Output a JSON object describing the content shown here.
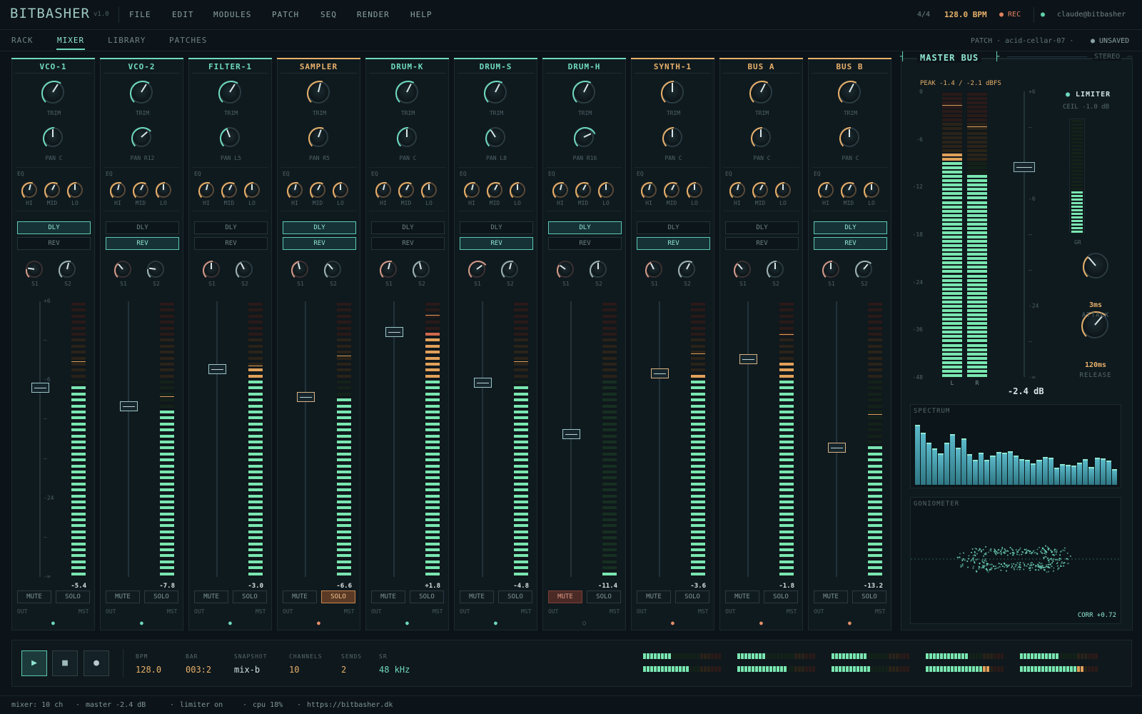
{
  "app": {
    "logo": "BITBASHER",
    "version": "v1.0"
  },
  "menu": [
    "FILE",
    "EDIT",
    "MODULES",
    "PATCH",
    "SEQ",
    "RENDER",
    "HELP"
  ],
  "top": {
    "time_sig": "4/4",
    "bpm": "128.0 BPM",
    "rec": "● REC",
    "user_dot": "●",
    "user": "claude@bitbasher"
  },
  "tabs": [
    "RACK",
    "MIXER",
    "LIBRARY",
    "PATCHES"
  ],
  "active_tab": "MIXER",
  "patch": {
    "label": "PATCH · acid-cellar-07 ·",
    "status": "● UNSAVED"
  },
  "channels": [
    {
      "name": "VCO-1",
      "color": "teal",
      "trim": 0.62,
      "pan_label": "PAN C",
      "pan": 0,
      "dly": true,
      "rev": false,
      "s1": 0.2,
      "s2": 0.55,
      "fader_db": -5.4,
      "meter_db": -5.4,
      "peak_db": -2.0,
      "gain": "-5.4",
      "mute": false,
      "solo": false,
      "route_dot": "teal"
    },
    {
      "name": "VCO-2",
      "color": "teal",
      "trim": 0.62,
      "pan_label": "PAN R12",
      "pan": 0.12,
      "dly": false,
      "rev": true,
      "s1": 0.35,
      "s2": 0.2,
      "fader_db": -7.8,
      "meter_db": -7.8,
      "peak_db": -6.5,
      "gain": "-7.8",
      "mute": false,
      "solo": false,
      "route_dot": "teal"
    },
    {
      "name": "FILTER-1",
      "color": "teal",
      "trim": 0.62,
      "pan_label": "PAN L5",
      "pan": -0.05,
      "dly": false,
      "rev": false,
      "s1": 0.5,
      "s2": 0.4,
      "fader_db": -3.0,
      "meter_db": -3.0,
      "peak_db": -2.6,
      "gain": "-3.0",
      "mute": false,
      "solo": false,
      "route_dot": "teal"
    },
    {
      "name": "SAMPLER",
      "color": "peach",
      "trim": 0.55,
      "pan_label": "PAN R5",
      "pan": 0.05,
      "dly": true,
      "rev": true,
      "s1": 0.45,
      "s2": 0.35,
      "fader_db": -6.6,
      "meter_db": -6.6,
      "peak_db": -1.3,
      "gain": "-6.6",
      "mute": false,
      "solo": true,
      "route_dot": "peach"
    },
    {
      "name": "DRUM-K",
      "color": "teal",
      "trim": 0.6,
      "pan_label": "PAN C",
      "pan": 0,
      "dly": false,
      "rev": false,
      "s1": 0.55,
      "s2": 0.45,
      "fader_db": 1.8,
      "meter_db": 1.8,
      "peak_db": 4.2,
      "gain": "+1.8",
      "mute": false,
      "solo": false,
      "route_dot": "teal"
    },
    {
      "name": "DRUM-S",
      "color": "teal",
      "trim": 0.6,
      "pan_label": "PAN L8",
      "pan": -0.08,
      "dly": false,
      "rev": true,
      "s1": 0.7,
      "s2": 0.55,
      "fader_db": -4.8,
      "meter_db": -4.8,
      "peak_db": -2.0,
      "gain": "-4.8",
      "mute": false,
      "solo": false,
      "route_dot": "teal"
    },
    {
      "name": "DRUM-H",
      "color": "teal",
      "trim": 0.6,
      "pan_label": "PAN R16",
      "pan": 0.16,
      "dly": true,
      "rev": false,
      "s1": 0.3,
      "s2": 0.5,
      "fader_db": -11.4,
      "meter_db": -48,
      "peak_db": -60,
      "gain": "-11.4",
      "mute": true,
      "solo": false,
      "route_dot": "off"
    },
    {
      "name": "SYNTH-1",
      "color": "peach",
      "trim": 0.5,
      "pan_label": "PAN C",
      "pan": 0,
      "dly": false,
      "rev": true,
      "s1": 0.4,
      "s2": 0.6,
      "fader_db": -3.6,
      "meter_db": -3.6,
      "peak_db": -1.0,
      "gain": "-3.6",
      "mute": false,
      "solo": false,
      "route_dot": "peach"
    },
    {
      "name": "BUS A",
      "color": "peach",
      "trim": 0.6,
      "pan_label": "PAN C",
      "pan": 0,
      "dly": false,
      "rev": false,
      "s1": 0.35,
      "s2": 0.5,
      "fader_db": -1.8,
      "meter_db": -1.8,
      "peak_db": 1.5,
      "gain": "-1.8",
      "mute": false,
      "solo": false,
      "route_dot": "peach"
    },
    {
      "name": "BUS B",
      "color": "peach",
      "trim": 0.6,
      "pan_label": "PAN C",
      "pan": 0,
      "dly": true,
      "rev": true,
      "s1": 0.5,
      "s2": 0.65,
      "fader_db": -13.2,
      "meter_db": -13.2,
      "peak_db": -8.8,
      "gain": "-13.2",
      "mute": false,
      "solo": false,
      "route_dot": "peach"
    }
  ],
  "strip_labels": {
    "trim": "TRIM",
    "eq": "EQ",
    "hi": "HI",
    "mid": "MID",
    "lo": "LO",
    "dly": "DLY",
    "rev": "REV",
    "s1": "S1",
    "s2": "S2",
    "mute": "MUTE",
    "solo": "SOLO",
    "out": "OUT",
    "mst": "MST"
  },
  "fader_scale": [
    "+6",
    "—",
    "-6",
    "—",
    "—",
    "-24",
    "—",
    "-∞"
  ],
  "master": {
    "title": "MASTER BUS",
    "mode": "STEREO",
    "peak": "PEAK -1.4 / -2.1 dBFS",
    "meter_scale": [
      "0",
      "-6",
      "-12",
      "-18",
      "-24",
      "-36",
      "-48"
    ],
    "fader_scale": [
      "+6",
      "—",
      "—",
      "-6",
      "—",
      "—",
      "-24",
      "—",
      "-∞"
    ],
    "level_l": -10.4,
    "level_r": -13.5,
    "peak_l": -2.3,
    "peak_r": -5.9,
    "meter_labels": [
      "L",
      "R"
    ],
    "fader_db": -2.4,
    "fader_readout": "-2.4 dB",
    "limiter": {
      "dot": "●",
      "label": "LIMITER",
      "ceil": "CEIL -1.0 dB",
      "gr": 0.35,
      "gr_label": "GR"
    },
    "attack": {
      "value": "3ms",
      "label": "ATTACK"
    },
    "release": {
      "value": "120ms",
      "label": "RELEASE"
    },
    "spectrum": {
      "title": "SPECTRUM",
      "bars": [
        0.94,
        0.82,
        0.66,
        0.57,
        0.49,
        0.66,
        0.8,
        0.58,
        0.73,
        0.48,
        0.39,
        0.5,
        0.39,
        0.46,
        0.51,
        0.5,
        0.52,
        0.45,
        0.4,
        0.39,
        0.33,
        0.39,
        0.43,
        0.42,
        0.26,
        0.32,
        0.31,
        0.29,
        0.34,
        0.4,
        0.27,
        0.42,
        0.41,
        0.37,
        0.24
      ]
    },
    "goniometer": {
      "title": "GONIOMETER",
      "corr": "CORR +0.72"
    }
  },
  "transport": {
    "buttons": [
      "▶",
      "■",
      "●"
    ],
    "fields": [
      {
        "label": "BPM",
        "value": "128.0",
        "color": "#e8b06a"
      },
      {
        "label": "BAR",
        "value": "003:2",
        "color": "#e8b06a"
      },
      {
        "label": "SNAPSHOT",
        "value": "mix-b",
        "color": "#cfe2e2"
      },
      {
        "label": "CHANNELS",
        "value": "10",
        "color": "#e8b06a"
      },
      {
        "label": "SENDS",
        "value": "2",
        "color": "#e8b06a"
      },
      {
        "label": "SR",
        "value": "48 kHz",
        "color": "#6fd9c0"
      }
    ],
    "mini_meters": [
      [
        0.35,
        0.6
      ],
      [
        0.38,
        0.65
      ],
      [
        0.45,
        0.52
      ],
      [
        0.55,
        0.8
      ],
      [
        0.5,
        0.82
      ]
    ]
  },
  "status": [
    "mixer: 10 ch",
    "·",
    "master -2.4 dB",
    "·",
    "limiter on",
    "·",
    "cpu 18%",
    "·",
    "https://bitbasher.dk"
  ],
  "colors": {
    "teal": "#6fd9c0",
    "peach": "#e8b06a",
    "meter_green": "#79e6b0",
    "meter_amber": "#e0a05a",
    "meter_red": "#d0684c",
    "bg": "#0c1419"
  }
}
